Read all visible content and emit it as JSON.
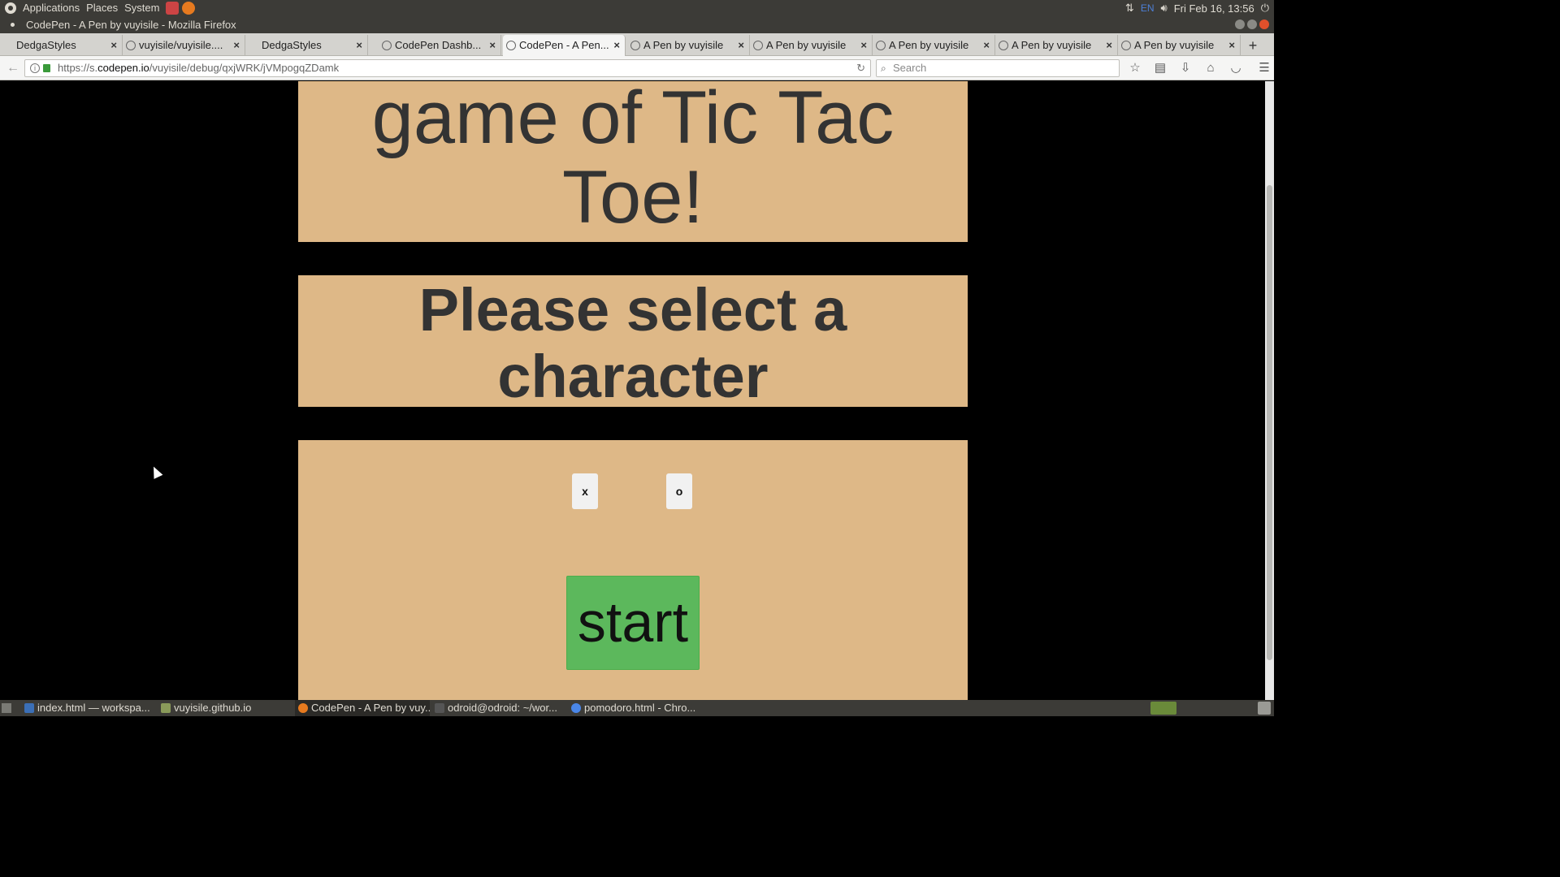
{
  "top_panel": {
    "menus": [
      "Applications",
      "Places",
      "System"
    ],
    "language": "EN",
    "datetime": "Fri Feb 16, 13:56"
  },
  "window": {
    "title": "CodePen - A Pen by vuyisile - Mozilla Firefox"
  },
  "tabs": [
    {
      "label": "DedgaStyles",
      "active": false
    },
    {
      "label": "vuyisile/vuyisile....",
      "active": false
    },
    {
      "label": "DedgaStyles",
      "active": false
    },
    {
      "label": "CodePen Dashb...",
      "active": false
    },
    {
      "label": "CodePen - A Pen...",
      "active": true
    },
    {
      "label": "A Pen by vuyisile",
      "active": false
    },
    {
      "label": "A Pen by vuyisile",
      "active": false
    },
    {
      "label": "A Pen by vuyisile",
      "active": false
    },
    {
      "label": "A Pen by vuyisile",
      "active": false
    },
    {
      "label": "A Pen by vuyisile",
      "active": false
    }
  ],
  "navbar": {
    "url_prefix": "https://s.",
    "url_host": "codepen.io",
    "url_path": "/vuyisile/debug/qxjWRK/jVMpogqZDamk",
    "search_placeholder": "Search"
  },
  "page": {
    "title": "game of Tic Tac Toe!",
    "prompt": "Please select a character",
    "char_x": "x",
    "char_o": "o",
    "start_label": "start",
    "colors": {
      "background": "#000000",
      "panel": "#deb887",
      "start_button": "#5cb85c"
    }
  },
  "taskbar": {
    "items": [
      {
        "label": "index.html — workspa...",
        "icon": "editor-icon"
      },
      {
        "label": "vuyisile.github.io",
        "icon": "folder-icon"
      },
      {
        "label": "CodePen - A Pen by vuy...",
        "icon": "firefox-icon"
      },
      {
        "label": "odroid@odroid: ~/wor...",
        "icon": "terminal-icon"
      },
      {
        "label": "pomodoro.html - Chro...",
        "icon": "chrome-icon"
      }
    ]
  }
}
